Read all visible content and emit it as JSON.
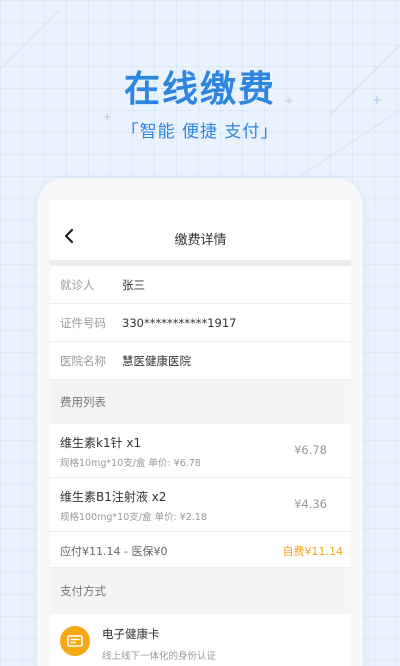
{
  "hero": {
    "title": "在线缴费",
    "subtitle": "「智能 便捷 支付」"
  },
  "nav": {
    "back_icon": "chevron-left-icon",
    "title": "缴费详情"
  },
  "info": [
    {
      "label": "就诊人",
      "value": "张三"
    },
    {
      "label": "证件号码",
      "value": "330***********1917"
    },
    {
      "label": "医院名称",
      "value": "慧医健康医院"
    }
  ],
  "fees": {
    "header": "费用列表",
    "items": [
      {
        "name": "维生素k1针 x1",
        "spec": "规格10mg*10支/盒 单价: ¥6.78",
        "price": "¥6.78"
      },
      {
        "name": "维生素B1注射液 x2",
        "spec": "规格100mg*10支/盒 单价: ¥2.18",
        "price": "¥4.36"
      }
    ],
    "summary_left": "应付¥11.14 - 医保¥0",
    "summary_label": "自费",
    "summary_amount": "¥11.14"
  },
  "payment": {
    "header": "支付方式",
    "method_icon": "card-icon",
    "method_name": "电子健康卡",
    "method_desc": "线上线下一体化的身份认证"
  },
  "colors": {
    "brand_blue": "#2f86e0",
    "accent_orange": "#f5a915"
  }
}
